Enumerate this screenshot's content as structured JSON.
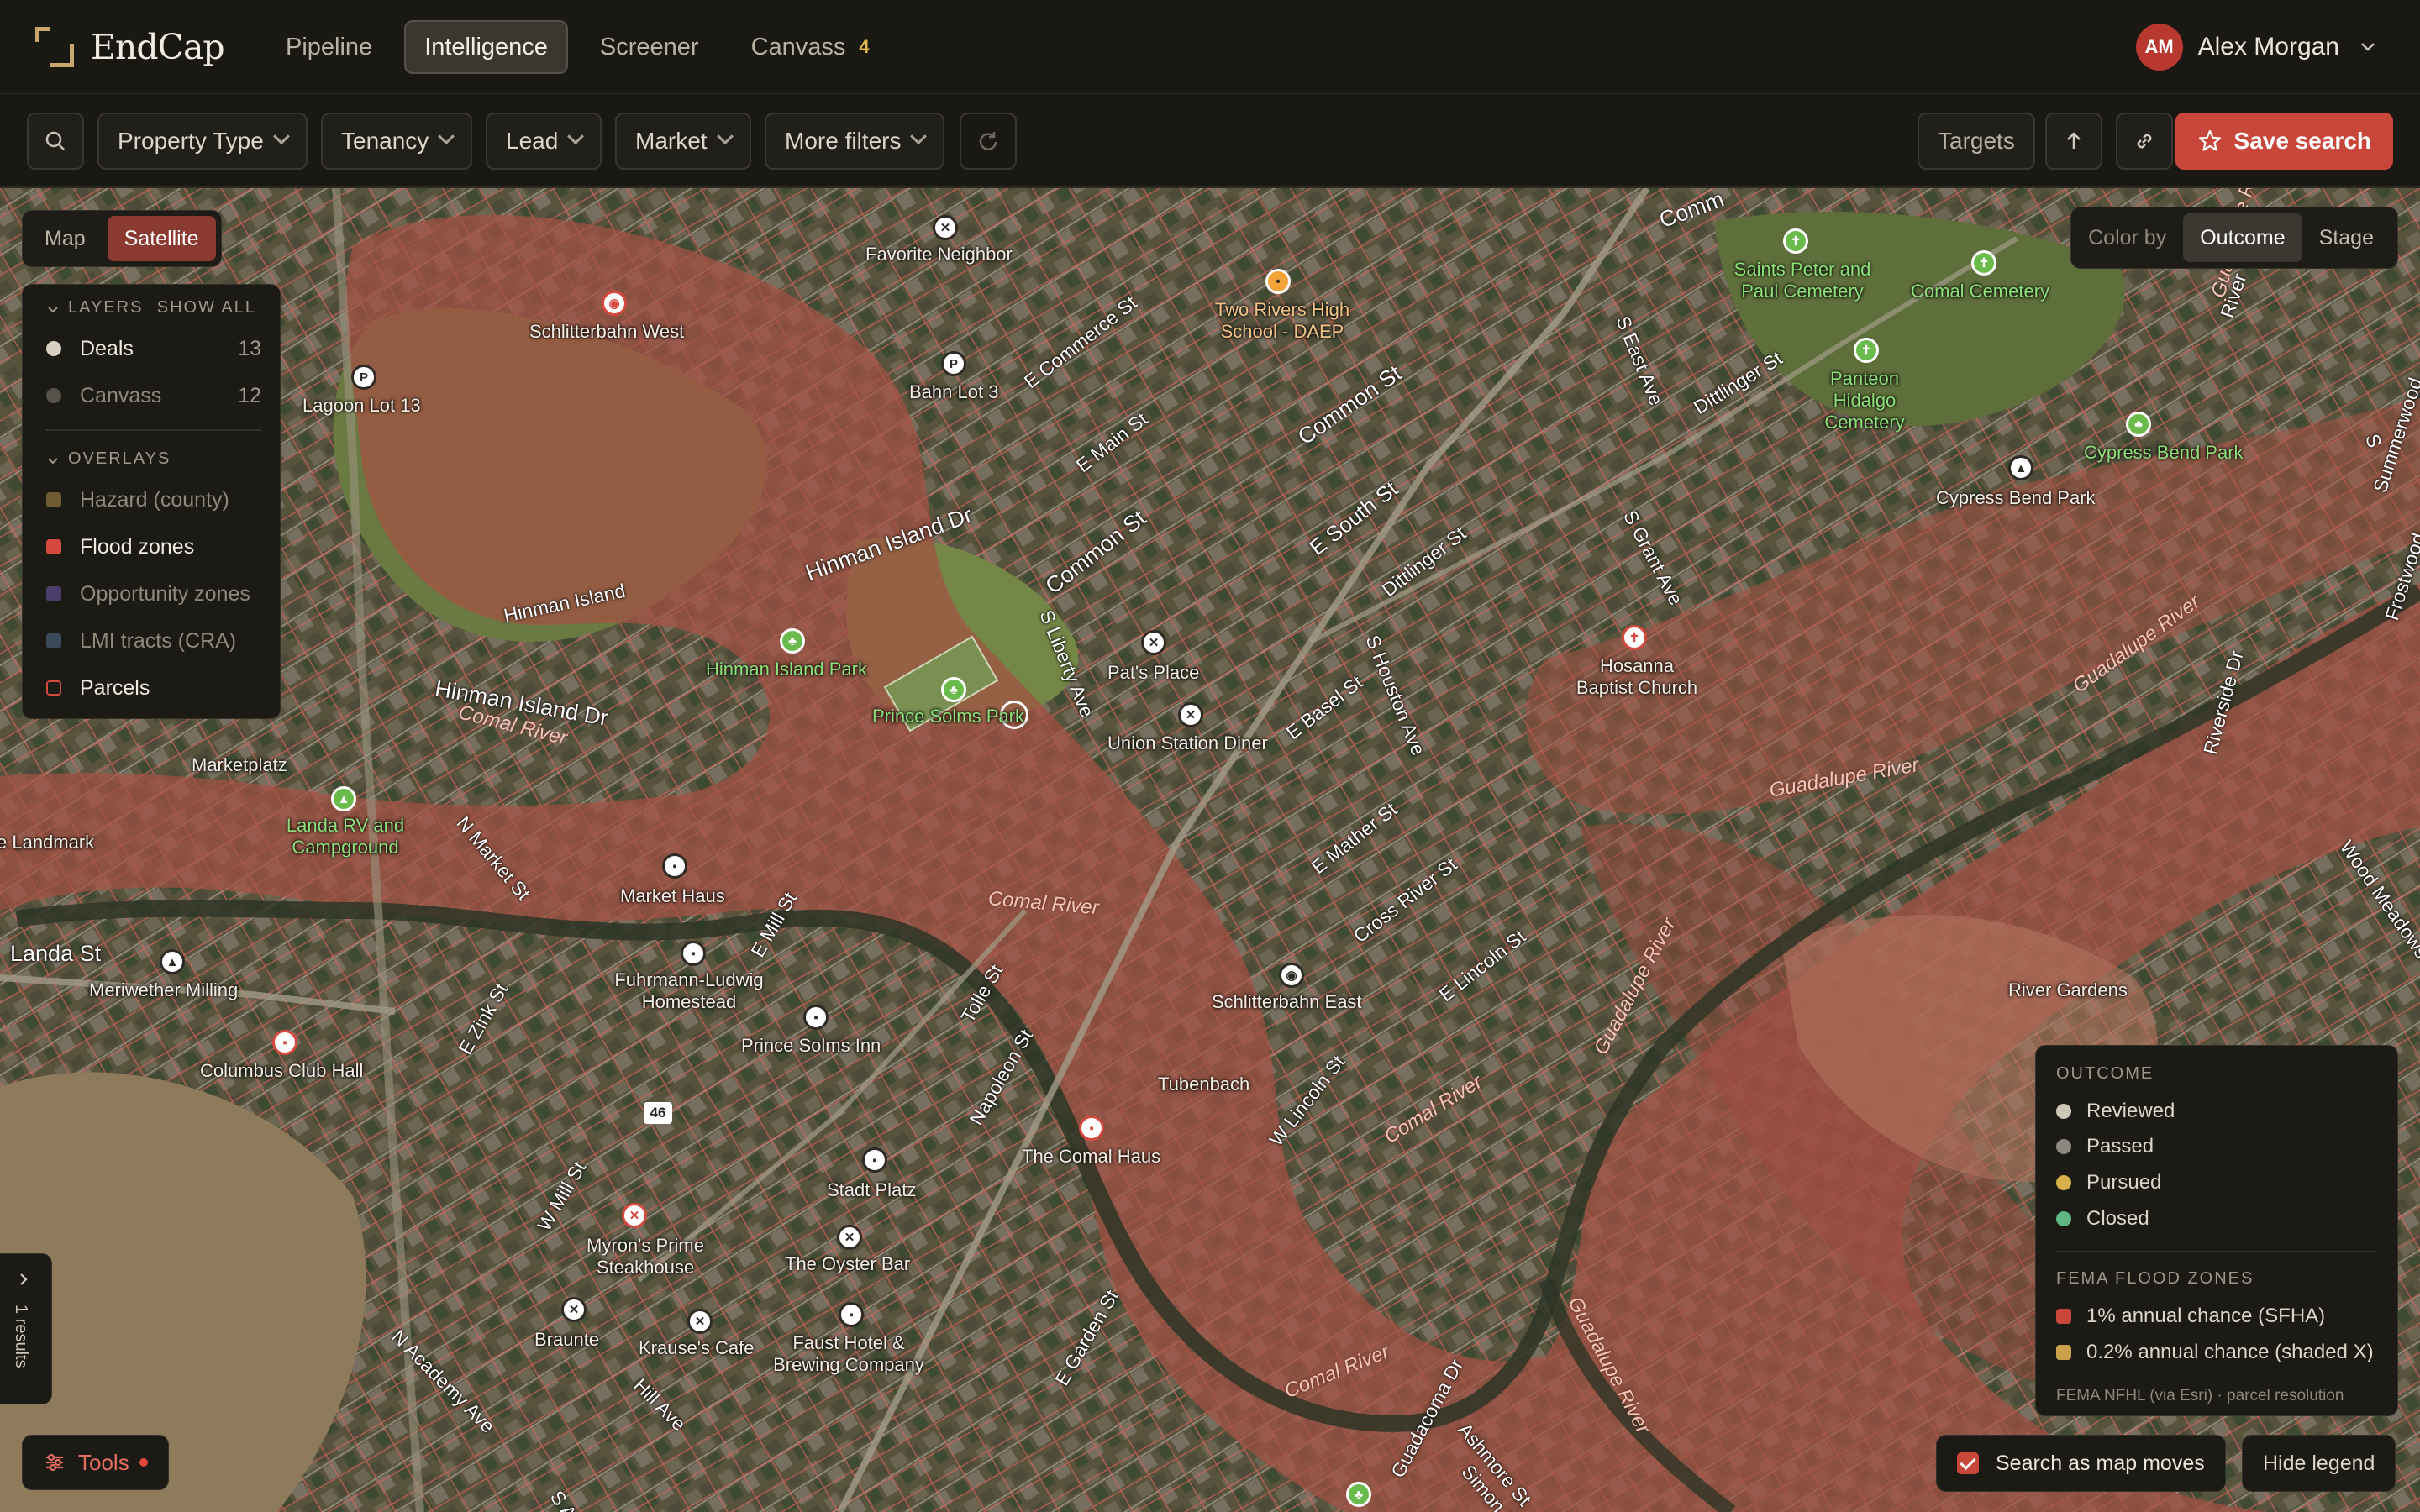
{
  "brand": {
    "name": "EndCap"
  },
  "nav": {
    "items": [
      {
        "label": "Pipeline"
      },
      {
        "label": "Intelligence"
      },
      {
        "label": "Screener"
      },
      {
        "label": "Canvass",
        "badge": "4"
      }
    ],
    "active": "Intelligence"
  },
  "user": {
    "initials": "AM",
    "name": "Alex Morgan"
  },
  "filters": {
    "property_type": "Property Type",
    "tenancy": "Tenancy",
    "lead": "Lead",
    "market": "Market",
    "more": "More filters",
    "targets": "Targets",
    "save": "Save search"
  },
  "map_mode": {
    "map": "Map",
    "satellite": "Satellite",
    "selected": "Satellite"
  },
  "layers": {
    "heading": "LAYERS",
    "show_all": "SHOW ALL",
    "items": [
      {
        "label": "Deals",
        "count": "13",
        "color": "#d8d1c2"
      },
      {
        "label": "Canvass",
        "count": "12",
        "color": "#55524a"
      }
    ],
    "overlays_heading": "OVERLAYS",
    "overlays": [
      {
        "label": "Hazard (county)",
        "color": "#6f5a34",
        "active": false
      },
      {
        "label": "Flood zones",
        "color": "#d6493e",
        "active": true
      },
      {
        "label": "Opportunity zones",
        "color": "#4a3f6a",
        "active": false
      },
      {
        "label": "LMI tracts (CRA)",
        "color": "#3a4a5a",
        "active": false
      },
      {
        "label": "Parcels",
        "color": "#d6493e",
        "active": true
      }
    ]
  },
  "color_by": {
    "label": "Color by",
    "outcome": "Outcome",
    "stage": "Stage",
    "selected": "Outcome"
  },
  "legend": {
    "outcome_heading": "OUTCOME",
    "outcome": [
      {
        "label": "Reviewed",
        "color": "#cfc8b8"
      },
      {
        "label": "Passed",
        "color": "#8c887f"
      },
      {
        "label": "Pursued",
        "color": "#d6b04a"
      },
      {
        "label": "Closed",
        "color": "#5fb783"
      }
    ],
    "flood_heading": "FEMA FLOOD ZONES",
    "flood": [
      {
        "label": "1% annual chance (SFHA)",
        "color": "#c8463a"
      },
      {
        "label": "0.2% annual chance (shaded X)",
        "color": "#c9a24a"
      }
    ],
    "note": "FEMA NFHL (via Esri) · parcel resolution"
  },
  "bottom": {
    "tools": "Tools",
    "results": "1 results",
    "search_as_moves": "Search as map moves",
    "hide_legend": "Hide legend"
  },
  "map_labels": {
    "favorite_neighbor": "Favorite Neighbor",
    "two_rivers": "Two Rivers High School - DAEP",
    "saints": "Saints Peter and Paul Cemetery",
    "comal_cemetery": "Comal Cemetery",
    "panteon": "Panteon Hidalgo Cemetery",
    "cypress_park": "Cypress Bend Park",
    "cypress_park2": "Cypress Bend Park",
    "schlitterbahn_west": "Schlitterbahn West",
    "lagoon": "Lagoon Lot 13",
    "bahn_lot": "Bahn Lot 3",
    "hinman_island": "Hinman Island",
    "hinman_island_park": "Hinman Island Park",
    "prince_solms_park": "Prince Solms Park",
    "pats_place": "Pat's Place",
    "union_station": "Union Station Diner",
    "hosanna": "Hosanna Baptist Church",
    "marketplatz": "Marketplatz",
    "landa_rv": "Landa RV and Campground",
    "landmark": "e Landmark",
    "market_haus": "Market Haus",
    "landa_st": "Landa St",
    "meriwether": "Meriwether Milling",
    "fuhrmann": "Fuhrmann-Ludwig Homestead",
    "prince_solms_inn": "Prince Solms Inn",
    "columbus": "Columbus Club Hall",
    "schlitterbahn_east": "Schlitterbahn East",
    "tubenbach": "Tubenbach",
    "comal_haus": "The Comal Haus",
    "stadt_platz": "Stadt Platz",
    "myrons": "Myron's Prime Steakhouse",
    "oyster_bar": "The Oyster Bar",
    "braunte": "Braunte",
    "krauses": "Krause's Cafe",
    "faust": "Faust Hotel & Brewing Company",
    "river_gardens": "River Gardens",
    "hwy46": "46"
  },
  "streets": {
    "commerce": "E Commerce St",
    "main": "E Main St",
    "common1": "Common St",
    "common2": "Common St",
    "comm_top": "Comm",
    "southst": "E South St",
    "dittlinger1": "Dittlinger St",
    "dittlinger2": "Dittlinger St",
    "seast": "S East Ave",
    "sgrant": "S Grant Ave",
    "hinman_dr1": "Hinman Island Dr",
    "hinman_dr2": "Hinman Island Dr",
    "sliberty": "S Liberty Ave",
    "shouston": "S Houston Ave",
    "ebasel": "E Basel St",
    "emather": "E Mather St",
    "crossriver": "Cross River St",
    "elincoln": "E Lincoln St",
    "nmarket": "N Market St",
    "emill": "E Mill St",
    "ezink": "E Zink St",
    "wmill": "W Mill St",
    "tolle": "Tolle St",
    "napoleon": "Napoleon St",
    "wlincoln": "W Lincoln St",
    "egarden": "E Garden St",
    "nacademy": "N Academy Ave",
    "sacademy": "S Academy",
    "hill": "Hill Ave",
    "guadacoma": "Guadacoma Dr",
    "ashmore": "Ashmore St",
    "simon": "Simon Ave",
    "riverside": "Riverside Dr",
    "frostwood": "Frostwood",
    "summerwood": "Summerwood",
    "wood_meadows": "Wood Meadows",
    "river_edge": "River",
    "sst": "S"
  },
  "rivers": {
    "comal1": "Comal River",
    "comal2": "Comal River",
    "comal3": "Comal River",
    "comal4": "Comal River",
    "guadalupe1": "Guadalupe River",
    "guadalupe2": "Guadalupe River",
    "guadalupe3": "Guadalupe River",
    "guadalupe4": "Guadalupe River",
    "guadalupe5": "Guadalupe River"
  }
}
